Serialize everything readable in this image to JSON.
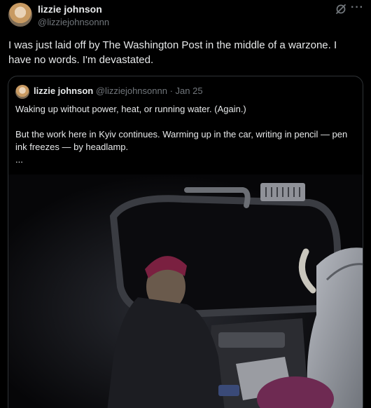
{
  "author": {
    "name": "lizzie johnson",
    "handle": "@lizziejohnsonnn"
  },
  "icons": {
    "grok": "grok-icon",
    "more": "more-options-icon"
  },
  "more_label": "···",
  "tweet": {
    "text": "I was just laid off by The Washington Post in the middle of a warzone. I have no words. I'm devastated."
  },
  "quote": {
    "name": "lizzie johnson",
    "handle": "@lizziejohnsonnn",
    "separator": "·",
    "date": "Jan 25",
    "line1": "Waking up without power, heat, or running water. (Again.)",
    "line2": "But the work here in Kyiv continues. Warming up in the car, writing in pencil — pen ink freezes — by headlamp.",
    "line3": "..."
  }
}
